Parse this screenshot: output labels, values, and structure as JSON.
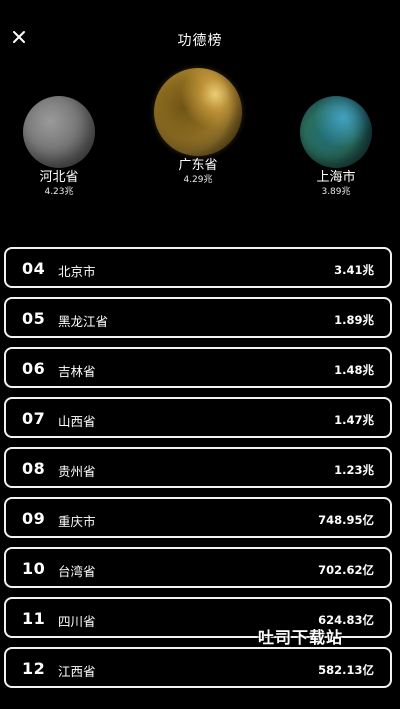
{
  "header": {
    "title": "功德榜",
    "close_icon": "close-icon"
  },
  "podium": [
    {
      "rank": 2,
      "name": "河北省",
      "value": "4.23兆",
      "color": "#7a7a7a"
    },
    {
      "rank": 1,
      "name": "广东省",
      "value": "4.29兆",
      "color": "#b38c34"
    },
    {
      "rank": 3,
      "name": "上海市",
      "value": "3.89兆",
      "color": "#2a6e5e"
    }
  ],
  "list": [
    {
      "rank": "04",
      "name": "北京市",
      "value": "3.41兆"
    },
    {
      "rank": "05",
      "name": "黑龙江省",
      "value": "1.89兆"
    },
    {
      "rank": "06",
      "name": "吉林省",
      "value": "1.48兆"
    },
    {
      "rank": "07",
      "name": "山西省",
      "value": "1.47兆"
    },
    {
      "rank": "08",
      "name": "贵州省",
      "value": "1.23兆"
    },
    {
      "rank": "09",
      "name": "重庆市",
      "value": "748.95亿"
    },
    {
      "rank": "10",
      "name": "台湾省",
      "value": "702.62亿"
    },
    {
      "rank": "11",
      "name": "四川省",
      "value": "624.83亿"
    },
    {
      "rank": "12",
      "name": "江西省",
      "value": "582.13亿"
    }
  ],
  "watermark": "吐司下载站"
}
